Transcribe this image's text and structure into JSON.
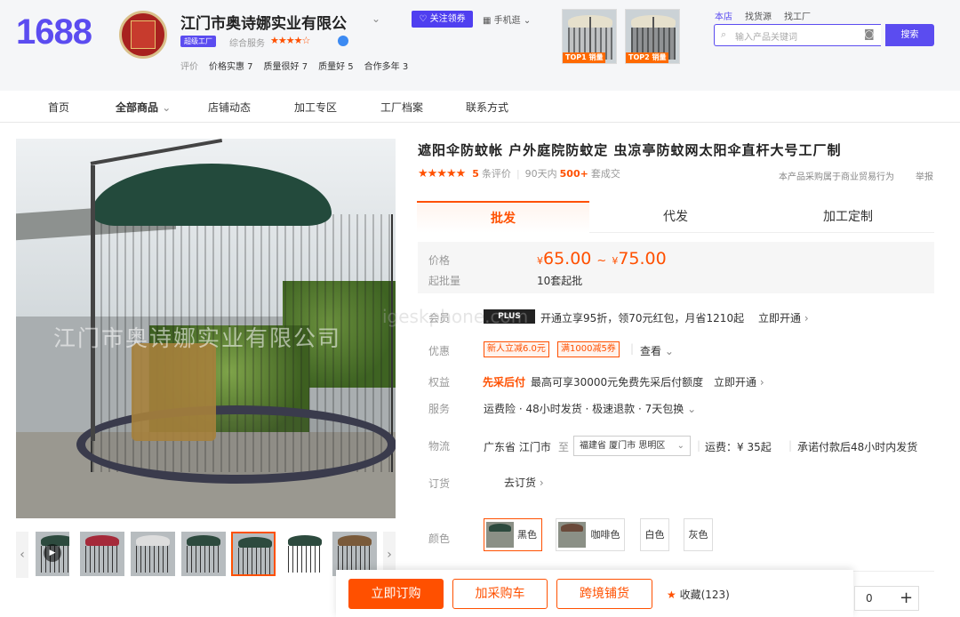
{
  "header": {
    "logo": "1688",
    "shop_name": "江门市奥诗娜实业有限公",
    "follow_label": "关注领券",
    "mobile_label": "手机逛",
    "factory_badge": "超级工厂",
    "service_label": "综合服务",
    "service_stars": "★★★★☆",
    "eval_label": "评价",
    "evals": [
      "价格实惠 7",
      "质量很好 7",
      "质量好 5",
      "合作多年 3"
    ],
    "top_products": [
      {
        "tag": "TOP1 销量"
      },
      {
        "tag": "TOP2 销量"
      }
    ],
    "search_tabs": [
      "本店",
      "找货源",
      "找工厂"
    ],
    "search_placeholder": "输入产品关键词",
    "search_button": "搜索"
  },
  "nav": {
    "items": [
      "首页",
      "全部商品",
      "店铺动态",
      "加工专区",
      "工厂档案",
      "联系方式"
    ]
  },
  "gallery": {
    "watermark": "江门市奥诗娜实业有限公司",
    "thumb_count": 7,
    "selected_index": 4
  },
  "product": {
    "title": "遮阳伞防蚊帐 户外庭院防蚊定 虫凉亭防蚊网太阳伞直杆大号工厂制",
    "rating_stars": "★★★★★",
    "review_count": "5",
    "review_label": "条评价",
    "deal_period": "90天内",
    "deal_count": "500+",
    "deal_label": "套成交",
    "trade_notice": "本产品采购属于商业贸易行为",
    "report": "举报",
    "tabs": [
      "批发",
      "代发",
      "加工定制"
    ],
    "price_label": "价格",
    "currency": "¥",
    "price_low": "65.00",
    "price_high": "75.00",
    "moq_label": "起批量",
    "moq": "10套起批",
    "member_label": "会员",
    "member_badge": "PLUS",
    "member_text": "开通立享95折，领70元红包，月省1210起",
    "member_link": "立即开通",
    "promo_label": "优惠",
    "coupons": [
      "新人立减6.0元",
      "满1000减5券"
    ],
    "promo_view": "查看",
    "rights_label": "权益",
    "rights_badge": "先采后付",
    "rights_text": "最高可享30000元免费先采后付额度",
    "rights_link": "立即开通",
    "service_label": "服务",
    "service_text": "运费险 · 48小时发货 · 极速退款 · 7天包换",
    "logistics_label": "物流",
    "ship_from": "广东省 江门市",
    "ship_to_label": "至",
    "ship_to": "福建省 厦门市 思明区",
    "freight": "运费：¥ 35起",
    "ship_promise": "承诺付款后48小时内发货",
    "order_label": "订货",
    "order_link": "去订货",
    "color_label": "颜色",
    "colors": [
      "黑色",
      "咖啡色",
      "白色",
      "灰色"
    ],
    "quantity": "0"
  },
  "actions": {
    "buy_now": "立即订购",
    "add_cart": "加采购车",
    "cross_border": "跨境铺货",
    "favorite": "收藏(123)"
  }
}
